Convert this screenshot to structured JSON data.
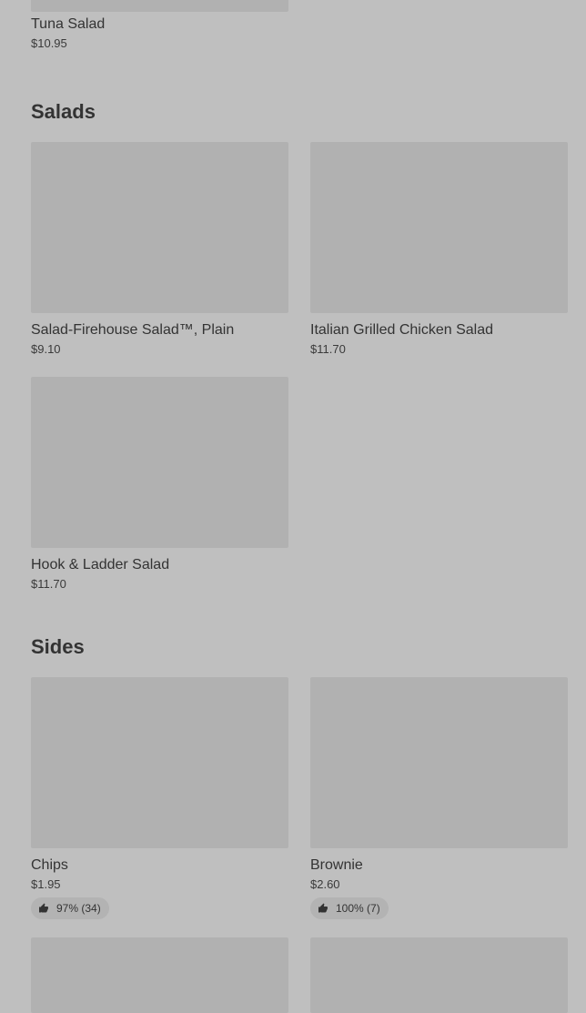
{
  "sections": {
    "previous": {
      "items": [
        {
          "name": "Tuna Salad",
          "price": "$10.95"
        }
      ]
    },
    "salads": {
      "title": "Salads",
      "items": [
        {
          "name": "Salad-Firehouse Salad™, Plain",
          "price": "$9.10"
        },
        {
          "name": "Italian Grilled Chicken Salad",
          "price": "$11.70"
        },
        {
          "name": "Hook & Ladder Salad",
          "price": "$11.70"
        }
      ]
    },
    "sides": {
      "title": "Sides",
      "items": [
        {
          "name": "Chips",
          "price": "$1.95",
          "rating": "97% (34)"
        },
        {
          "name": "Brownie",
          "price": "$2.60",
          "rating": "100% (7)"
        }
      ]
    }
  },
  "icons": {
    "rating": "thumbs-up-icon"
  }
}
